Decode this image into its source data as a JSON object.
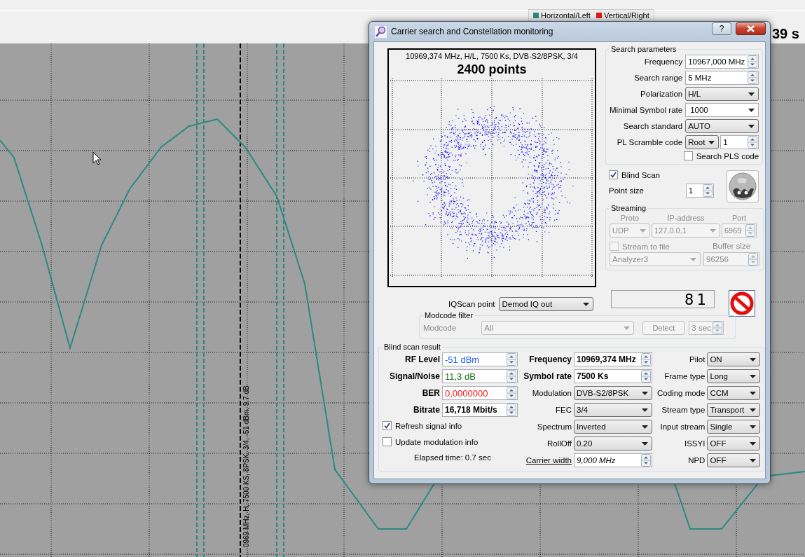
{
  "background": {
    "legend": [
      {
        "label": "Horizontal/Left",
        "color": "#2a8a80"
      },
      {
        "label": "Vertical/Right",
        "color": "#e01818"
      }
    ],
    "header_text": "39 s",
    "marker_label": "0969 MHz, H, 7500 KS, 8PSK, 3/4, -51 dBm, 9.7 dB"
  },
  "dialog": {
    "title": "Carrier search and Constellation monitoring",
    "help_button": "?",
    "constellation": {
      "caption": "10969,374 MHz, H/L, 7500 Ks, DVB-S2/8PSK, 3/4",
      "title": "2400 points"
    },
    "iqscan": {
      "label": "IQScan point",
      "value": "Demod IQ out"
    },
    "counter": "81",
    "modcode_filter": {
      "title": "Modcode filter",
      "disabled": true,
      "label": "Modcode",
      "value": "All",
      "button": "Detect",
      "timeout": "3 sec"
    },
    "search_parameters": {
      "title": "Search parameters",
      "rows": [
        {
          "label": "Frequency",
          "kind": "spin",
          "value": "10967,000 MHz"
        },
        {
          "label": "Search range",
          "kind": "spin",
          "value": "5 MHz"
        },
        {
          "label": "Polarization",
          "kind": "combo",
          "value": "H/L"
        },
        {
          "label": "Minimal Symbol rate",
          "kind": "editcombo",
          "value": "1000"
        },
        {
          "label": "Search standard",
          "kind": "combo",
          "value": "AUTO"
        },
        {
          "label": "PL Scramble code",
          "kind": "combospin",
          "value": "Root",
          "value2": "1"
        }
      ],
      "search_pls": {
        "label": "Search PLS code",
        "checked": false
      }
    },
    "blind_scan": {
      "label": "Blind Scan",
      "checked": true
    },
    "point_size": {
      "label": "Point size",
      "value": "1"
    },
    "streaming": {
      "title": "Streaming",
      "disabled": true,
      "proto": {
        "label": "Proto",
        "value": "UDP"
      },
      "ip": {
        "label": "IP-address",
        "value": "127.0.0.1"
      },
      "port": {
        "label": "Port",
        "value": "6969"
      },
      "stream_to_file": {
        "label": "Stream to file",
        "checked": false
      },
      "file": "Analyzer3",
      "buffer": {
        "label": "Buffer size",
        "value": "96256"
      }
    },
    "result": {
      "title": "Blind scan result",
      "signal": [
        {
          "label": "RF Level",
          "value": "-51 dBm",
          "color": "#1a5cff"
        },
        {
          "label": "Signal/Noise",
          "value": "11,3 dB",
          "color": "#1a6b1a"
        },
        {
          "label": "BER",
          "value": "0,0000000",
          "color": "#ff1010"
        },
        {
          "label": "Bitrate",
          "value": "16,718 Mbit/s",
          "color": "#000000"
        }
      ],
      "checks": [
        {
          "label": "Refresh signal info",
          "checked": true
        },
        {
          "label": "Update modulation info",
          "checked": false
        }
      ],
      "elapsed": "Elapsed time: 0.7 sec",
      "middle": [
        {
          "label": "Frequency",
          "kind": "bold-spin",
          "value": "10969,374 MHz"
        },
        {
          "label": "Symbol rate",
          "kind": "bold-spin",
          "value": "7500 Ks"
        },
        {
          "label": "Modulation",
          "kind": "combo",
          "value": "DVB-S2/8PSK"
        },
        {
          "label": "FEC",
          "kind": "combo",
          "value": "3/4"
        },
        {
          "label": "Spectrum",
          "kind": "combo",
          "value": "Inverted"
        },
        {
          "label": "RollOff",
          "kind": "combo",
          "value": "0.20"
        },
        {
          "label": "Carrier width",
          "kind": "link-spin",
          "value": "9,000 MHz"
        }
      ],
      "right": [
        {
          "label": "Pilot",
          "value": "ON"
        },
        {
          "label": "Frame type",
          "value": "Long"
        },
        {
          "label": "Coding mode",
          "value": "CCM"
        },
        {
          "label": "Stream type",
          "value": "Transport"
        },
        {
          "label": "Input stream",
          "value": "Single"
        },
        {
          "label": "ISSYI",
          "value": "OFF"
        },
        {
          "label": "NPD",
          "value": "OFF"
        }
      ]
    }
  }
}
